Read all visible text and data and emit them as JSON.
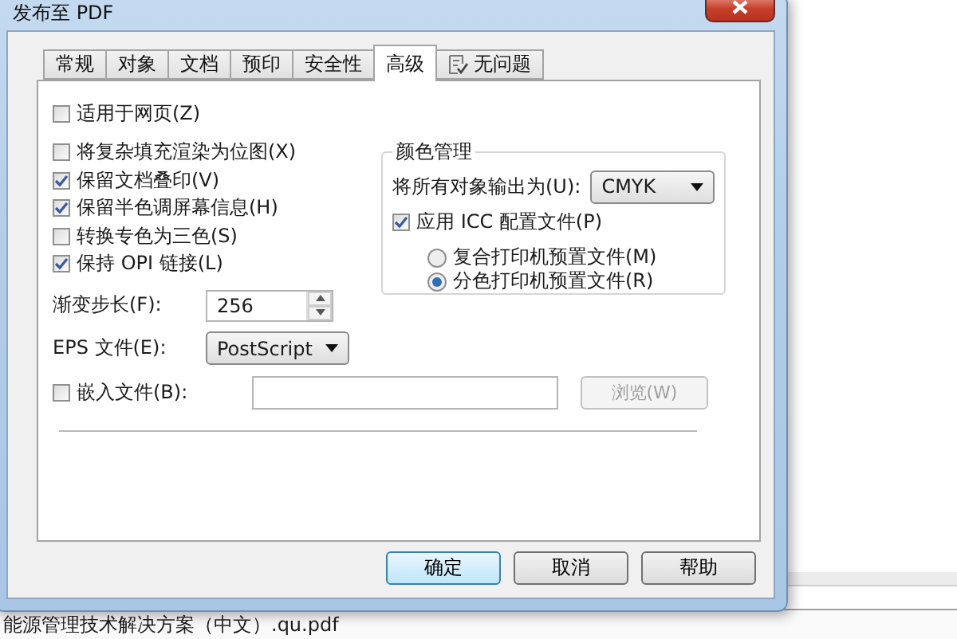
{
  "window": {
    "title": "发布至 PDF"
  },
  "tabs": [
    {
      "label": "常规",
      "selected": false,
      "kind": "text"
    },
    {
      "label": "对象",
      "selected": false,
      "kind": "text"
    },
    {
      "label": "文档",
      "selected": false,
      "kind": "text"
    },
    {
      "label": "预印",
      "selected": false,
      "kind": "text"
    },
    {
      "label": "安全性",
      "selected": false,
      "kind": "text"
    },
    {
      "label": "高级",
      "selected": true,
      "kind": "text"
    },
    {
      "label": "无问题",
      "selected": false,
      "kind": "check"
    }
  ],
  "web_option": {
    "label": "适用于网页(Z)",
    "checked": false
  },
  "options": [
    {
      "label": "将复杂填充渲染为位图(X)",
      "checked": false
    },
    {
      "label": "保留文档叠印(V)",
      "checked": true
    },
    {
      "label": "保留半色调屏幕信息(H)",
      "checked": true
    },
    {
      "label": "转换专色为三色(S)",
      "checked": false
    },
    {
      "label": "保持 OPI 链接(L)",
      "checked": true
    }
  ],
  "gradient_steps": {
    "label": "渐变步长(F):",
    "value": "256"
  },
  "eps_file": {
    "label": "EPS 文件(E):",
    "value": "PostScript"
  },
  "embed_file": {
    "label": "嵌入文件(B):",
    "checked": false,
    "browse_button": {
      "label": "浏览(W)",
      "disabled": true
    }
  },
  "color_management": {
    "title": "颜色管理",
    "output_label": "将所有对象输出为(U):",
    "output_value": "CMYK",
    "apply_icc": {
      "label": "应用 ICC 配置文件(P)",
      "checked": true
    },
    "profiles": [
      {
        "label": "复合打印机预置文件(M)",
        "selected": false
      },
      {
        "label": "分色打印机预置文件(R)",
        "selected": true
      }
    ]
  },
  "buttons": [
    {
      "label": "确定",
      "default": true
    },
    {
      "label": "取消",
      "default": false
    },
    {
      "label": "帮助",
      "default": false
    }
  ],
  "background_file": "能源管理技术解决方案（中文）.qu.pdf"
}
